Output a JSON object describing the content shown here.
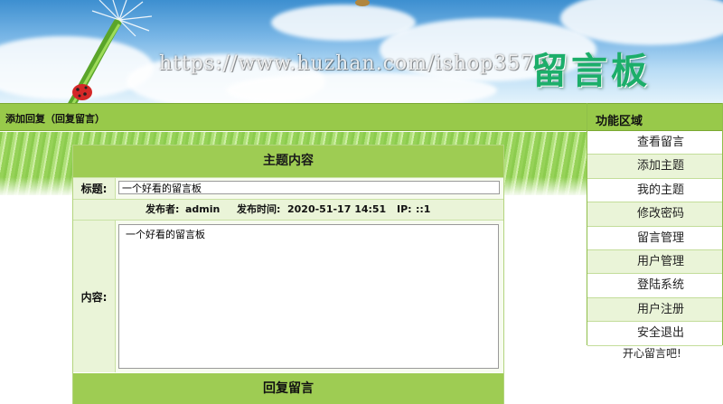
{
  "banner": {
    "watermark": "https://www.huzhan.com/ishop3572",
    "logo": "留言板"
  },
  "topbar": {
    "title": "添加回复（回复留言）"
  },
  "sidebar": {
    "header": "功能区域",
    "items": [
      {
        "label": "查看留言"
      },
      {
        "label": "添加主题"
      },
      {
        "label": "我的主题"
      },
      {
        "label": "修改密码"
      },
      {
        "label": "留言管理"
      },
      {
        "label": "用户管理"
      },
      {
        "label": "登陆系统"
      },
      {
        "label": "用户注册"
      },
      {
        "label": "安全退出"
      }
    ],
    "footer": "开心留言吧!"
  },
  "main": {
    "panel_title": "主题内容",
    "title_label": "标题:",
    "title_value": "一个好看的留言板",
    "meta": {
      "author_label": "发布者:",
      "author": "admin",
      "time_label": "发布时间:",
      "time": "2020-51-17 14:51",
      "ip_label": "IP:",
      "ip": "::1"
    },
    "content_label": "内容:",
    "content_value": "一个好看的留言板",
    "reply_title": "回复留言"
  }
}
